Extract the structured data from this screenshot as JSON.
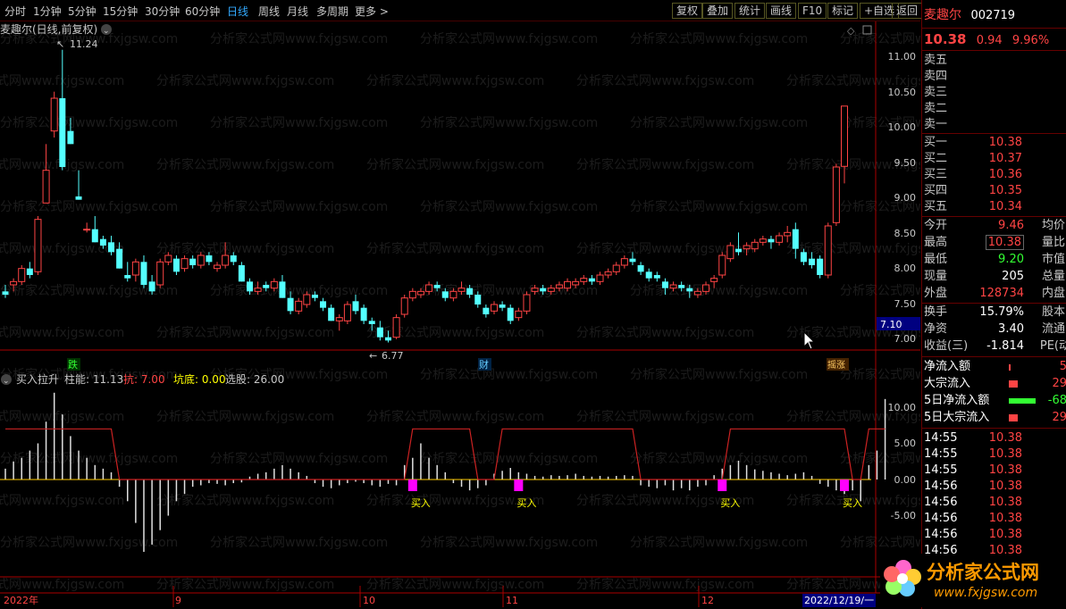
{
  "toolbar": {
    "periods": [
      "分时",
      "1分钟",
      "5分钟",
      "15分钟",
      "30分钟",
      "60分钟",
      "日线",
      "周线",
      "月线",
      "多周期",
      "更多 >"
    ],
    "active": "日线",
    "buttons": [
      "复权",
      "叠加",
      "统计",
      "画线",
      "F10",
      "标记",
      "+自选",
      "返回"
    ]
  },
  "main": {
    "title": "麦趣尔(日线,前复权)",
    "max_label": "11.24",
    "min_label": "6.77",
    "yaxis": [
      "11.00",
      "10.50",
      "10.00",
      "9.50",
      "9.00",
      "8.50",
      "8.00",
      "7.50",
      "7.00"
    ],
    "price_tag": "7.10",
    "markers": [
      "跌",
      "财",
      "摇涨"
    ]
  },
  "indicator": {
    "name": "买入拉升",
    "line1_label": "柱能: 11.13",
    "line2_label": "抗: 7.00",
    "line3_label": "坑底: 0.00",
    "line4_label": "选股: 26.00",
    "yaxis": [
      "10.00",
      "5.00",
      "0.00",
      "-5.00"
    ],
    "buy_label": "买入"
  },
  "xaxis": [
    "2022年",
    "9",
    "10",
    "11",
    "12",
    "2022/12/19/一"
  ],
  "stock": {
    "name": "麦趣尔",
    "code": "002719",
    "price": "10.38",
    "change": "0.94",
    "pct": "9.96%"
  },
  "orderbook": {
    "asks": [
      {
        "label": "卖五",
        "price": ""
      },
      {
        "label": "卖四",
        "price": ""
      },
      {
        "label": "卖三",
        "price": ""
      },
      {
        "label": "卖二",
        "price": ""
      },
      {
        "label": "卖一",
        "price": ""
      }
    ],
    "bids": [
      {
        "label": "买一",
        "price": "10.38"
      },
      {
        "label": "买二",
        "price": "10.37"
      },
      {
        "label": "买三",
        "price": "10.36"
      },
      {
        "label": "买四",
        "price": "10.35"
      },
      {
        "label": "买五",
        "price": "10.34"
      }
    ]
  },
  "quote": {
    "open_label": "今开",
    "open": "9.46",
    "avg_label": "均价",
    "high_label": "最高",
    "high": "10.38",
    "vr_label": "量比",
    "low_label": "最低",
    "low": "9.20",
    "mv_label": "市值",
    "cur_label": "现量",
    "cur": "205",
    "tot_label": "总量",
    "out_label": "外盘",
    "out": "128734",
    "in_label": "内盘",
    "turn_label": "换手",
    "turn": "15.79%",
    "cap_label": "股本",
    "nav_label": "净资",
    "nav": "3.40",
    "float_label": "流通",
    "eps_label": "收益(三)",
    "eps": "-1.814",
    "pe_label": "PE(动"
  },
  "flows": [
    {
      "label": "净流入额",
      "value": "5"
    },
    {
      "label": "大宗流入",
      "value": "29"
    },
    {
      "label": "5日净流入额",
      "value": "-68"
    },
    {
      "label": "5日大宗流入",
      "value": "29"
    }
  ],
  "ticks": [
    {
      "time": "14:55",
      "price": "10.38"
    },
    {
      "time": "14:55",
      "price": "10.38"
    },
    {
      "time": "14:55",
      "price": "10.38"
    },
    {
      "time": "14:56",
      "price": "10.38"
    },
    {
      "time": "14:56",
      "price": "10.38"
    },
    {
      "time": "14:56",
      "price": "10.38"
    },
    {
      "time": "14:56",
      "price": "10.38"
    },
    {
      "time": "14:56",
      "price": "10.38"
    }
  ],
  "watermark": "分析家公式网www.fxjgsw.com",
  "logo": {
    "text": "分析家公式网",
    "url": "www.fxjgsw.com"
  },
  "colors": {
    "up": "#ff4444",
    "down": "#54ffff",
    "axis": "#aa0000",
    "text": "#c8c8c8",
    "buy": "#ff00ff"
  },
  "chart_data": {
    "type": "candlestick",
    "ylim": [
      6.6,
      11.4
    ],
    "candles": [
      [
        7.55,
        7.65,
        7.45,
        7.5
      ],
      [
        7.65,
        7.75,
        7.55,
        7.7
      ],
      [
        7.7,
        7.95,
        7.65,
        7.9
      ],
      [
        7.9,
        8.0,
        7.75,
        7.8
      ],
      [
        7.85,
        8.7,
        7.8,
        8.65
      ],
      [
        8.9,
        9.8,
        8.9,
        9.4
      ],
      [
        10.0,
        10.6,
        9.9,
        10.5
      ],
      [
        10.5,
        11.24,
        9.4,
        9.45
      ],
      [
        10.0,
        10.2,
        9.8,
        9.8
      ],
      [
        9.0,
        9.4,
        8.95,
        8.95
      ],
      [
        8.5,
        8.6,
        8.45,
        8.5
      ],
      [
        8.5,
        8.7,
        8.3,
        8.3
      ],
      [
        8.35,
        8.4,
        8.2,
        8.25
      ],
      [
        8.3,
        8.4,
        8.1,
        8.15
      ],
      [
        8.2,
        8.3,
        7.9,
        7.9
      ],
      [
        7.8,
        8.0,
        7.7,
        7.75
      ],
      [
        7.8,
        8.05,
        7.7,
        8.0
      ],
      [
        8.0,
        8.1,
        7.6,
        7.65
      ],
      [
        7.7,
        7.8,
        7.5,
        7.55
      ],
      [
        7.65,
        8.05,
        7.6,
        8.0
      ],
      [
        8.0,
        8.15,
        7.95,
        8.1
      ],
      [
        8.05,
        8.1,
        7.8,
        7.85
      ],
      [
        7.9,
        8.1,
        7.85,
        8.05
      ],
      [
        8.05,
        8.1,
        7.9,
        7.95
      ],
      [
        7.95,
        8.15,
        7.9,
        8.1
      ],
      [
        8.1,
        8.15,
        7.95,
        8.0
      ],
      [
        7.9,
        8.0,
        7.85,
        7.95
      ],
      [
        7.95,
        8.3,
        7.9,
        8.1
      ],
      [
        8.1,
        8.15,
        7.95,
        8.0
      ],
      [
        7.95,
        8.0,
        7.7,
        7.7
      ],
      [
        7.7,
        7.75,
        7.5,
        7.55
      ],
      [
        7.55,
        7.7,
        7.5,
        7.6
      ],
      [
        7.65,
        7.7,
        7.55,
        7.6
      ],
      [
        7.6,
        7.75,
        7.55,
        7.7
      ],
      [
        7.7,
        7.8,
        7.45,
        7.45
      ],
      [
        7.45,
        7.55,
        7.2,
        7.25
      ],
      [
        7.25,
        7.45,
        7.2,
        7.4
      ],
      [
        7.35,
        7.55,
        7.3,
        7.5
      ],
      [
        7.5,
        7.55,
        7.4,
        7.45
      ],
      [
        7.4,
        7.45,
        7.25,
        7.3
      ],
      [
        7.3,
        7.35,
        7.1,
        7.1
      ],
      [
        7.1,
        7.2,
        6.95,
        7.15
      ],
      [
        7.1,
        7.4,
        7.05,
        7.35
      ],
      [
        7.4,
        7.5,
        7.2,
        7.25
      ],
      [
        7.3,
        7.35,
        7.05,
        7.1
      ],
      [
        7.1,
        7.15,
        6.95,
        7.05
      ],
      [
        7.0,
        7.1,
        6.8,
        6.85
      ],
      [
        6.85,
        6.95,
        6.77,
        6.8
      ],
      [
        6.85,
        7.2,
        6.82,
        7.15
      ],
      [
        7.2,
        7.5,
        7.15,
        7.45
      ],
      [
        7.45,
        7.6,
        7.4,
        7.55
      ],
      [
        7.5,
        7.6,
        7.45,
        7.55
      ],
      [
        7.55,
        7.7,
        7.5,
        7.65
      ],
      [
        7.65,
        7.7,
        7.55,
        7.6
      ],
      [
        7.55,
        7.6,
        7.4,
        7.45
      ],
      [
        7.45,
        7.6,
        7.4,
        7.55
      ],
      [
        7.55,
        7.7,
        7.5,
        7.6
      ],
      [
        7.6,
        7.65,
        7.45,
        7.5
      ],
      [
        7.5,
        7.55,
        7.3,
        7.35
      ],
      [
        7.3,
        7.35,
        7.15,
        7.2
      ],
      [
        7.25,
        7.4,
        7.2,
        7.35
      ],
      [
        7.35,
        7.4,
        7.25,
        7.3
      ],
      [
        7.3,
        7.35,
        7.05,
        7.1
      ],
      [
        7.15,
        7.3,
        7.1,
        7.25
      ],
      [
        7.25,
        7.55,
        7.2,
        7.5
      ],
      [
        7.55,
        7.65,
        7.5,
        7.6
      ],
      [
        7.6,
        7.65,
        7.5,
        7.55
      ],
      [
        7.55,
        7.65,
        7.5,
        7.6
      ],
      [
        7.6,
        7.7,
        7.55,
        7.65
      ],
      [
        7.6,
        7.75,
        7.55,
        7.7
      ],
      [
        7.65,
        7.75,
        7.6,
        7.7
      ],
      [
        7.7,
        7.8,
        7.65,
        7.75
      ],
      [
        7.75,
        7.8,
        7.65,
        7.7
      ],
      [
        7.7,
        7.85,
        7.65,
        7.8
      ],
      [
        7.8,
        7.9,
        7.75,
        7.85
      ],
      [
        7.85,
        8.0,
        7.8,
        7.95
      ],
      [
        7.95,
        8.1,
        7.9,
        8.05
      ],
      [
        8.05,
        8.15,
        7.95,
        8.0
      ],
      [
        7.95,
        8.0,
        7.8,
        7.85
      ],
      [
        7.85,
        7.9,
        7.7,
        7.75
      ],
      [
        7.8,
        7.85,
        7.7,
        7.75
      ],
      [
        7.7,
        7.75,
        7.5,
        7.6
      ],
      [
        7.6,
        7.7,
        7.55,
        7.65
      ],
      [
        7.65,
        7.7,
        7.55,
        7.6
      ],
      [
        7.6,
        7.65,
        7.45,
        7.55
      ],
      [
        7.5,
        7.6,
        7.45,
        7.55
      ],
      [
        7.55,
        7.7,
        7.5,
        7.65
      ],
      [
        7.7,
        7.8,
        7.6,
        7.75
      ],
      [
        7.8,
        8.15,
        7.75,
        8.1
      ],
      [
        8.05,
        8.3,
        8.0,
        8.25
      ],
      [
        8.2,
        8.45,
        8.1,
        8.15
      ],
      [
        8.2,
        8.3,
        8.1,
        8.25
      ],
      [
        8.2,
        8.35,
        8.15,
        8.3
      ],
      [
        8.3,
        8.4,
        8.25,
        8.35
      ],
      [
        8.35,
        8.4,
        8.2,
        8.3
      ],
      [
        8.3,
        8.45,
        8.25,
        8.4
      ],
      [
        8.4,
        8.55,
        8.3,
        8.45
      ],
      [
        8.5,
        8.6,
        8.05,
        8.2
      ],
      [
        8.15,
        8.2,
        7.95,
        8.0
      ],
      [
        8.05,
        8.15,
        7.9,
        7.95
      ],
      [
        8.05,
        8.1,
        7.75,
        7.8
      ],
      [
        7.8,
        8.6,
        7.75,
        8.55
      ],
      [
        8.6,
        9.5,
        8.55,
        9.45
      ],
      [
        9.46,
        10.38,
        9.2,
        10.38
      ]
    ],
    "indicator": {
      "bars": [
        1.5,
        2.5,
        3,
        4,
        5,
        8,
        12,
        9,
        6,
        4,
        3,
        2,
        1.5,
        1,
        -1,
        -3,
        -6,
        -10,
        -9,
        -7,
        -5,
        -3,
        -2,
        -1,
        -0.8,
        -0.5,
        -0.6,
        -0.8,
        -0.5,
        -0.4,
        0.4,
        0.8,
        1,
        1.5,
        2,
        1.5,
        1,
        0.5,
        -0.5,
        -1,
        -1.2,
        -0.8,
        -0.5,
        -0.3,
        -0.5,
        -0.8,
        -1,
        -0.6,
        -0.8,
        2,
        3,
        5,
        3,
        2,
        1,
        -0.5,
        -1,
        -1.5,
        -1.2,
        -0.8,
        0.8,
        1.2,
        1.6,
        1,
        0.8,
        0.5,
        0.4,
        0.6,
        0.5,
        0.6,
        0.8,
        0.5,
        0.4,
        0.5,
        0.4,
        0.5,
        0.6,
        0.5,
        -0.8,
        -1,
        -1.2,
        -0.8,
        -1.5,
        -1.2,
        -1.5,
        -1,
        -0.8,
        0.6,
        1.5,
        2,
        2.6,
        2,
        1.4,
        1.2,
        1,
        0.8,
        0.6,
        0.8,
        1,
        0.5,
        -0.6,
        -1,
        -1.5,
        -2,
        -1.5,
        -3,
        2,
        4,
        11.13
      ],
      "line": [
        7,
        7,
        7,
        7,
        7,
        7,
        7,
        7,
        7,
        7,
        7,
        7,
        7,
        7,
        0,
        0,
        0,
        0,
        0,
        0,
        0,
        0,
        0,
        0,
        0,
        0,
        0,
        0,
        0,
        0,
        0,
        0,
        0,
        0,
        0,
        0,
        0,
        0,
        0,
        0,
        0,
        0,
        0,
        0,
        0,
        0,
        0,
        0,
        0,
        0,
        7,
        7,
        7,
        7,
        7,
        7,
        7,
        7,
        0,
        0,
        0,
        7,
        7,
        7,
        7,
        7,
        7,
        7,
        7,
        7,
        7,
        7,
        7,
        7,
        7,
        7,
        7,
        7,
        0,
        0,
        0,
        0,
        0,
        0,
        0,
        0,
        0,
        0,
        0,
        7,
        7,
        7,
        7,
        7,
        7,
        7,
        7,
        7,
        7,
        7,
        7,
        7,
        7,
        7,
        0,
        0,
        7,
        7,
        7
      ],
      "buy_index": [
        50,
        63,
        88,
        103
      ]
    }
  }
}
